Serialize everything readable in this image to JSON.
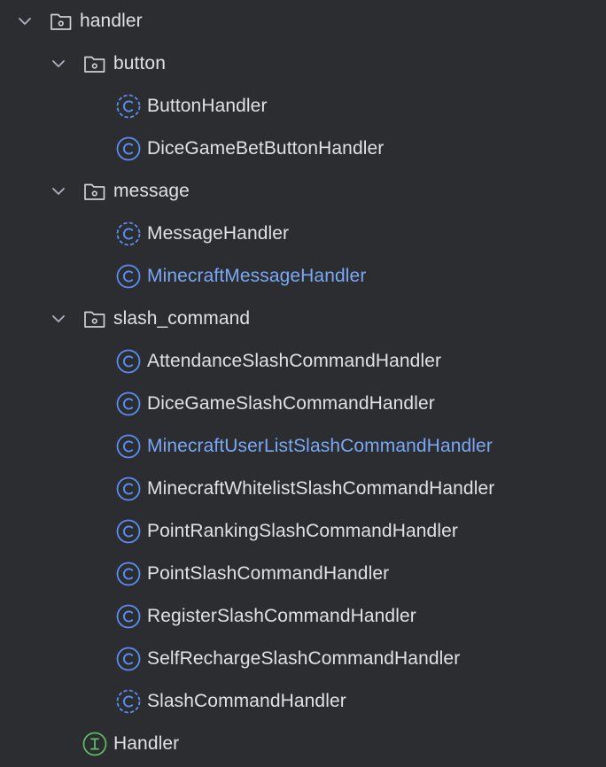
{
  "tree": {
    "root": {
      "label": "handler",
      "icon": "package-folder-icon",
      "expanded": true
    },
    "button_pkg": {
      "label": "button",
      "icon": "package-folder-icon",
      "expanded": true
    },
    "button_items": [
      {
        "label": "ButtonHandler",
        "icon": "abstract-class-icon",
        "status": "normal"
      },
      {
        "label": "DiceGameBetButtonHandler",
        "icon": "class-icon",
        "status": "normal"
      }
    ],
    "message_pkg": {
      "label": "message",
      "icon": "package-folder-icon",
      "expanded": true
    },
    "message_items": [
      {
        "label": "MessageHandler",
        "icon": "abstract-class-icon",
        "status": "normal"
      },
      {
        "label": "MinecraftMessageHandler",
        "icon": "class-icon",
        "status": "modified"
      }
    ],
    "slash_pkg": {
      "label": "slash_command",
      "icon": "package-folder-icon",
      "expanded": true
    },
    "slash_items": [
      {
        "label": "AttendanceSlashCommandHandler",
        "icon": "class-icon",
        "status": "normal"
      },
      {
        "label": "DiceGameSlashCommandHandler",
        "icon": "class-icon",
        "status": "normal"
      },
      {
        "label": "MinecraftUserListSlashCommandHandler",
        "icon": "class-icon",
        "status": "modified"
      },
      {
        "label": "MinecraftWhitelistSlashCommandHandler",
        "icon": "class-icon",
        "status": "normal"
      },
      {
        "label": "PointRankingSlashCommandHandler",
        "icon": "class-icon",
        "status": "normal"
      },
      {
        "label": "PointSlashCommandHandler",
        "icon": "class-icon",
        "status": "normal"
      },
      {
        "label": "RegisterSlashCommandHandler",
        "icon": "class-icon",
        "status": "normal"
      },
      {
        "label": "SelfRechargeSlashCommandHandler",
        "icon": "class-icon",
        "status": "normal"
      },
      {
        "label": "SlashCommandHandler",
        "icon": "abstract-class-icon",
        "status": "normal"
      }
    ],
    "interface_item": {
      "label": "Handler",
      "icon": "interface-icon",
      "status": "normal"
    }
  },
  "colors": {
    "background": "#2b2d30",
    "text": "#dfe1e5",
    "modified_text": "#7ba8f5",
    "class_icon": "#5b8ef0",
    "interface_icon": "#5fb865",
    "chevron": "#aeb3c2",
    "folder": "#ced0d6"
  }
}
